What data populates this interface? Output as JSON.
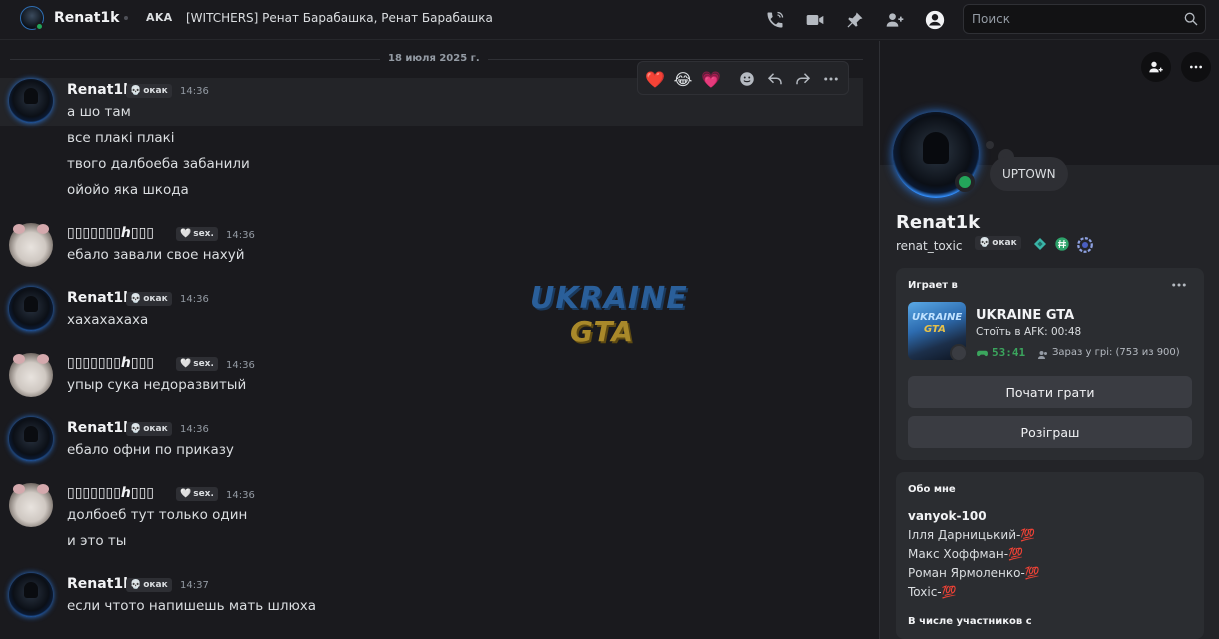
{
  "header": {
    "channel_name": "Renat1k",
    "aka_label": "AKA",
    "aka_names": "[WITCHERS] Ренат Барабашка, Ренат Барабашка",
    "icons": [
      "phone-call-icon",
      "video-call-icon",
      "pin-icon",
      "add-friends-icon",
      "user-profile-icon"
    ],
    "search_placeholder": "Поиск"
  },
  "chat": {
    "date_divider": "18 июля 2025 г.",
    "messages": [
      {
        "author": "Renat1k",
        "tag": "окак",
        "time": "14:36",
        "lines": [
          "а шо там",
          "все плакі плакі",
          "твого далбоеба забанили",
          "ойойо яка шкода"
        ]
      },
      {
        "author": "▯▯▯▯▯▯▯ℎ▯▯▯",
        "tag": "sex.",
        "time": "14:36",
        "lines": [
          "ебало завали свое нахуй"
        ]
      },
      {
        "author": "Renat1k",
        "tag": "окак",
        "time": "14:36",
        "lines": [
          "хахахахаха"
        ]
      },
      {
        "author": "▯▯▯▯▯▯▯ℎ▯▯▯",
        "tag": "sex.",
        "time": "14:36",
        "lines": [
          "упыр сука недоразвитый"
        ]
      },
      {
        "author": "Renat1k",
        "tag": "окак",
        "time": "14:36",
        "lines": [
          "ебало офни по приказу"
        ]
      },
      {
        "author": "▯▯▯▯▯▯▯ℎ▯▯▯",
        "tag": "sex.",
        "time": "14:36",
        "lines": [
          "долбоеб тут только один",
          "и это ты"
        ]
      },
      {
        "author": "Renat1k",
        "tag": "окак",
        "time": "14:37",
        "lines": [
          "если чтото напишешь мать шлюха"
        ]
      }
    ],
    "reactions": [
      "❤️",
      "😂",
      "💗"
    ],
    "watermark": {
      "line1": "UKRAINE",
      "line2": "GTA"
    }
  },
  "profile": {
    "display_name": "Renat1k",
    "username": "renat_toxic",
    "tag": "окак",
    "custom_status": "UPTOWN",
    "activity": {
      "title": "Играет в",
      "game": "UKRAINE GTA",
      "detail": "Стоїть в AFK: 00:48",
      "elapsed": "53:41",
      "players": "Зараз у грі: (753 из 900)",
      "thumb_line1": "UKRAINE",
      "thumb_line2": "GTA",
      "play_button": "Почати грати",
      "giveaway_button": "Розіграш"
    },
    "about": {
      "title": "Обо мне",
      "lines": [
        "vanyok-100",
        "Ілля Дарницький-💯",
        "Макс Хоффман-💯",
        "Роман Ярмоленко-💯",
        "Toxic-💯"
      ]
    },
    "member_of_title": "В числе участников с"
  },
  "colors": {
    "background": "#1a1a1e",
    "panel": "#232428",
    "card": "#2b2d31",
    "online": "#23a55a",
    "elapsed_green": "#3ba55d",
    "avatar_ring": "#2b7be4"
  }
}
